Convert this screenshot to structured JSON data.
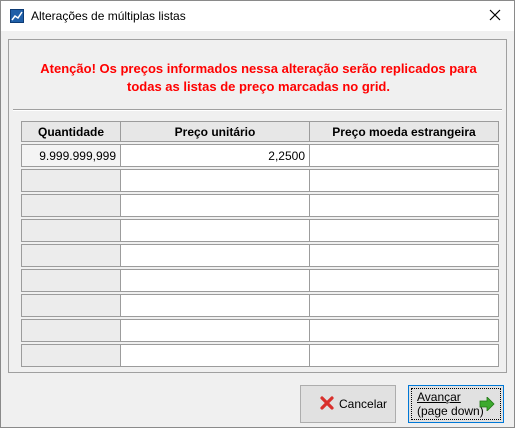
{
  "window": {
    "title": "Alterações de múltiplas listas",
    "icon": "app-chart-icon",
    "close_glyph": "✕"
  },
  "warning": {
    "line1": "Atenção! Os preços informados nessa alteração serão replicados para",
    "line2": "todas as listas de preço marcadas no grid.",
    "color": "#ff0000"
  },
  "grid": {
    "headers": [
      "Quantidade",
      "Preço unitário",
      "Preço moeda estrangeira"
    ],
    "rows": [
      [
        "9.999.999,999",
        "2,2500",
        ""
      ],
      [
        "",
        "",
        ""
      ],
      [
        "",
        "",
        ""
      ],
      [
        "",
        "",
        ""
      ],
      [
        "",
        "",
        ""
      ],
      [
        "",
        "",
        ""
      ],
      [
        "",
        "",
        ""
      ],
      [
        "",
        "",
        ""
      ],
      [
        "",
        "",
        ""
      ]
    ]
  },
  "buttons": {
    "cancel": {
      "label": "Cancelar",
      "icon": "red-x-icon"
    },
    "next": {
      "line1": "Avançar",
      "line2": "(page down)",
      "icon": "green-arrow-right-icon"
    }
  }
}
